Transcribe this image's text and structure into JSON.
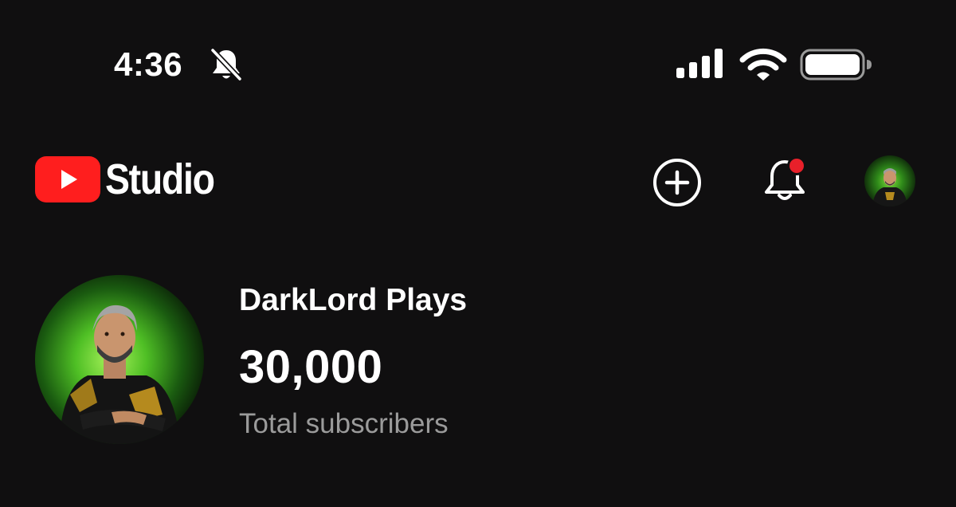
{
  "status_bar": {
    "time": "4:36",
    "icons": [
      "bell-muted-icon",
      "cellular-signal-icon",
      "wifi-icon",
      "battery-icon"
    ]
  },
  "header": {
    "app_name": "Studio",
    "logo_icon": "youtube-play-icon",
    "actions": [
      "create-icon",
      "notifications-bell-icon",
      "account-avatar"
    ],
    "notification_dot_color": "#e8202a"
  },
  "channel": {
    "name": "DarkLord Plays",
    "subscriber_count": "30,000",
    "subscriber_label": "Total subscribers"
  },
  "colors": {
    "background": "#100f10",
    "brand_red": "#ff1e1e",
    "secondary_text": "#9b9b9b"
  }
}
